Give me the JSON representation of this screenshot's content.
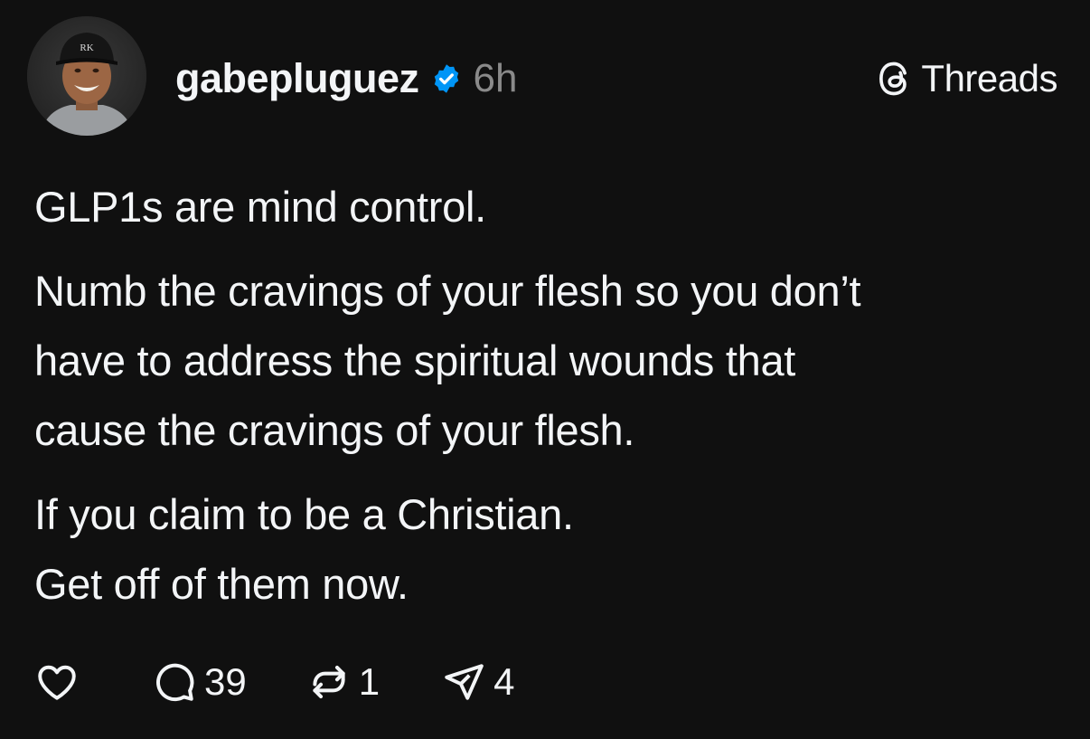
{
  "post": {
    "author": {
      "username": "gabepluguez",
      "verified_icon": "verified-badge-icon",
      "timestamp": "6h",
      "avatar_cap_text": "RK"
    },
    "brand": {
      "icon": "threads-logo-icon",
      "label": "Threads"
    },
    "body": {
      "paragraph_1": "GLP1s are mind control.",
      "paragraph_2_line_1": "Numb the cravings of your flesh so you don’t",
      "paragraph_2_line_2": "have to address the spiritual wounds that",
      "paragraph_2_line_3": "cause the cravings of your flesh.",
      "paragraph_3_line_1": "If you claim to be a Christian.",
      "paragraph_3_line_2": "Get off of them now."
    },
    "actions": {
      "like_icon": "heart-icon",
      "reply_icon": "comment-icon",
      "reply_count": "39",
      "repost_icon": "repost-icon",
      "repost_count": "1",
      "share_icon": "send-icon",
      "share_count": "4"
    }
  },
  "colors": {
    "background": "#101010",
    "text": "#f3f5f7",
    "muted": "#8a8a8a",
    "verified": "#0095f6"
  }
}
